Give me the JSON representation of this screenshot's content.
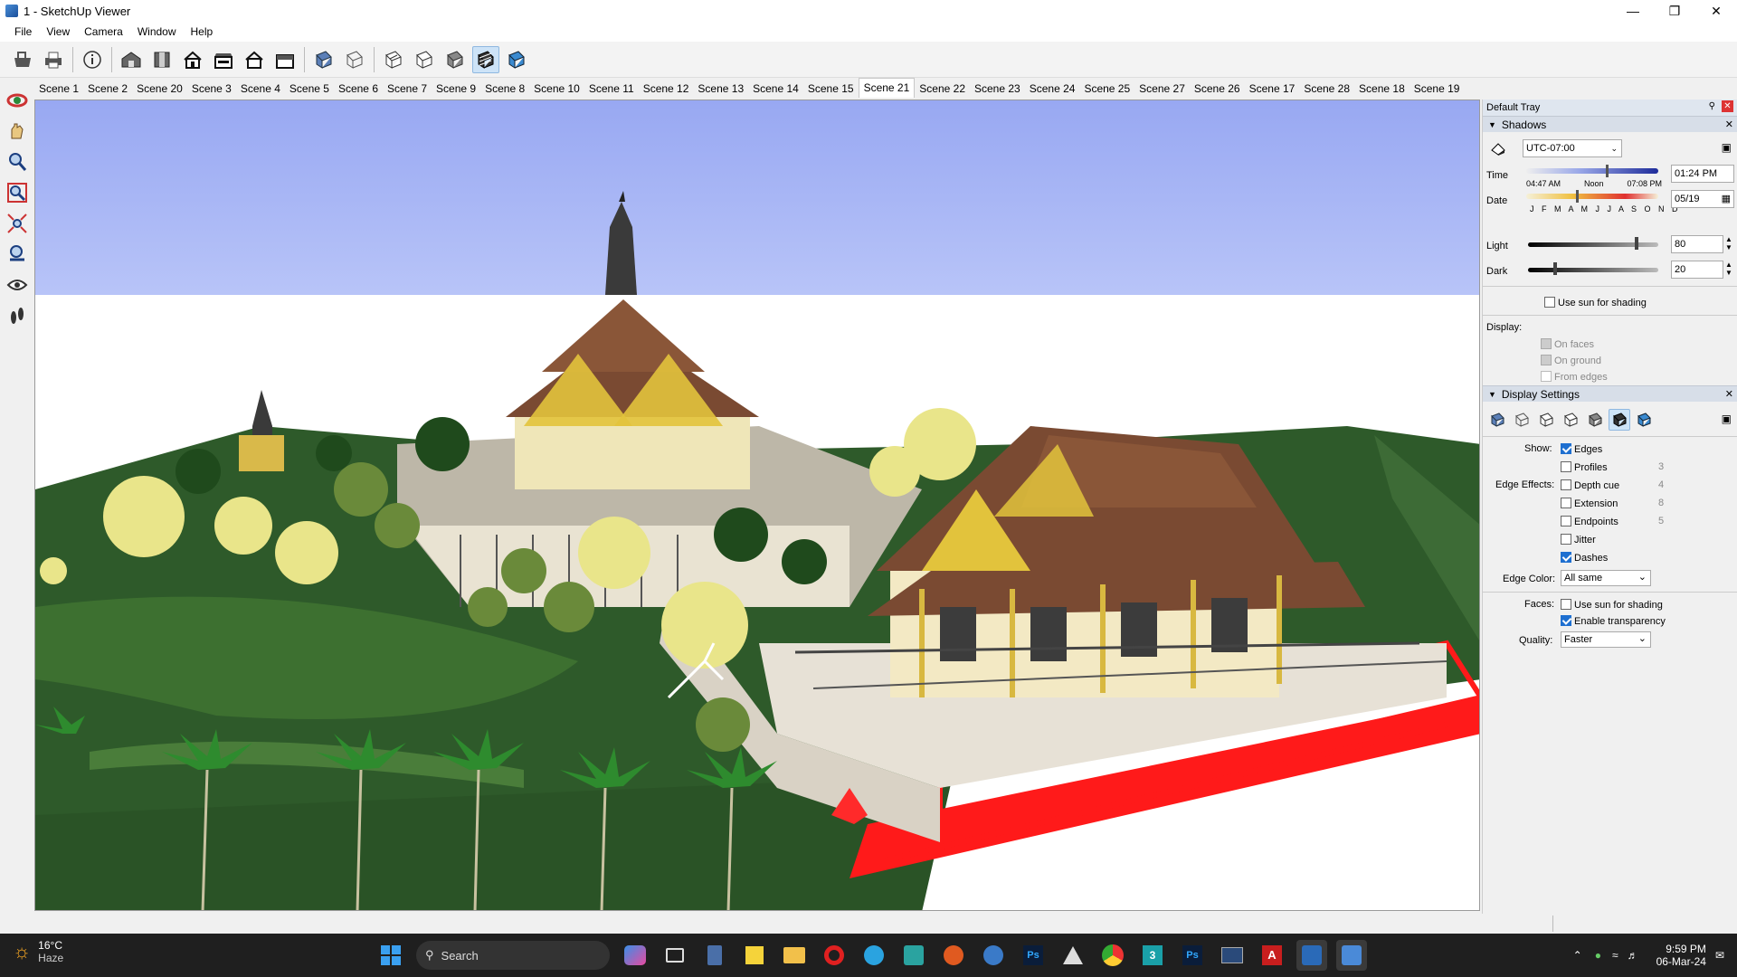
{
  "window": {
    "title": "1 - SketchUp Viewer",
    "icon": "sketchup-viewer-icon",
    "controls": [
      "minimize-icon",
      "restore-icon",
      "close-icon"
    ]
  },
  "menu": [
    "File",
    "View",
    "Camera",
    "Window",
    "Help"
  ],
  "toolbar": {
    "icons": [
      "open-icon",
      "print-icon",
      "model-info-icon",
      "iso-view-icon",
      "top-view-icon",
      "front-view-icon",
      "right-view-icon",
      "back-view-icon",
      "left-view-icon",
      "xray-icon",
      "wireframe-icon",
      "hidden-line-icon",
      "shaded-icon",
      "shaded-textures-icon",
      "monochrome-icon"
    ]
  },
  "scenes": [
    "Scene 1",
    "Scene 2",
    "Scene 20",
    "Scene 3",
    "Scene 4",
    "Scene 5",
    "Scene 6",
    "Scene 7",
    "Scene 9",
    "Scene 8",
    "Scene 10",
    "Scene 11",
    "Scene 12",
    "Scene 13",
    "Scene 14",
    "Scene 15",
    "Scene 21",
    "Scene 22",
    "Scene 23",
    "Scene 24",
    "Scene 25",
    "Scene 27",
    "Scene 26",
    "Scene 17",
    "Scene 28",
    "Scene 18",
    "Scene 19"
  ],
  "selected_scene": "Scene 21",
  "left_tools": [
    "orbit-icon",
    "pan-icon",
    "zoom-icon",
    "zoom-window-icon",
    "zoom-extents-icon",
    "position-camera-icon",
    "look-around-icon",
    "walk-icon"
  ],
  "tray": {
    "title": "Default Tray",
    "shadows": {
      "title": "Shadows",
      "timezone": "UTC-07:00",
      "time_label": "Time",
      "time_ticks": [
        "04:47 AM",
        "Noon",
        "07:08 PM"
      ],
      "time_value": "01:24 PM",
      "time_fraction": 0.6,
      "date_label": "Date",
      "months": "J F M A M J J A S O N D",
      "date_value": "05/19",
      "date_fraction": 0.38,
      "light_label": "Light",
      "light_value": "80",
      "dark_label": "Dark",
      "dark_value": "20",
      "use_sun": "Use sun for shading",
      "display_label": "Display:",
      "on_faces": "On faces",
      "on_ground": "On ground",
      "from_edges": "From edges"
    },
    "display": {
      "title": "Display Settings",
      "show_label": "Show:",
      "edges": "Edges",
      "edge_effects_label": "Edge Effects:",
      "profiles": "Profiles",
      "profiles_val": "3",
      "depth_cue": "Depth cue",
      "depth_val": "4",
      "extension": "Extension",
      "extension_val": "8",
      "endpoints": "Endpoints",
      "endpoints_val": "5",
      "jitter": "Jitter",
      "dashes": "Dashes",
      "edge_color_label": "Edge Color:",
      "edge_color": "All same",
      "faces_label": "Faces:",
      "faces_sun": "Use sun for shading",
      "transparency": "Enable transparency",
      "quality_label": "Quality:",
      "quality": "Faster"
    }
  },
  "taskbar": {
    "temp": "16°C",
    "weather": "Haze",
    "search": "Search",
    "time": "9:59 PM",
    "date": "06-Mar-24"
  },
  "colors": {
    "accent": "#1e6fd0",
    "sky": "#9fb0f0",
    "grass": "#2f5d2a",
    "roof": "#7a4a32",
    "gold": "#e2c33c",
    "red": "#ff1a1a"
  }
}
